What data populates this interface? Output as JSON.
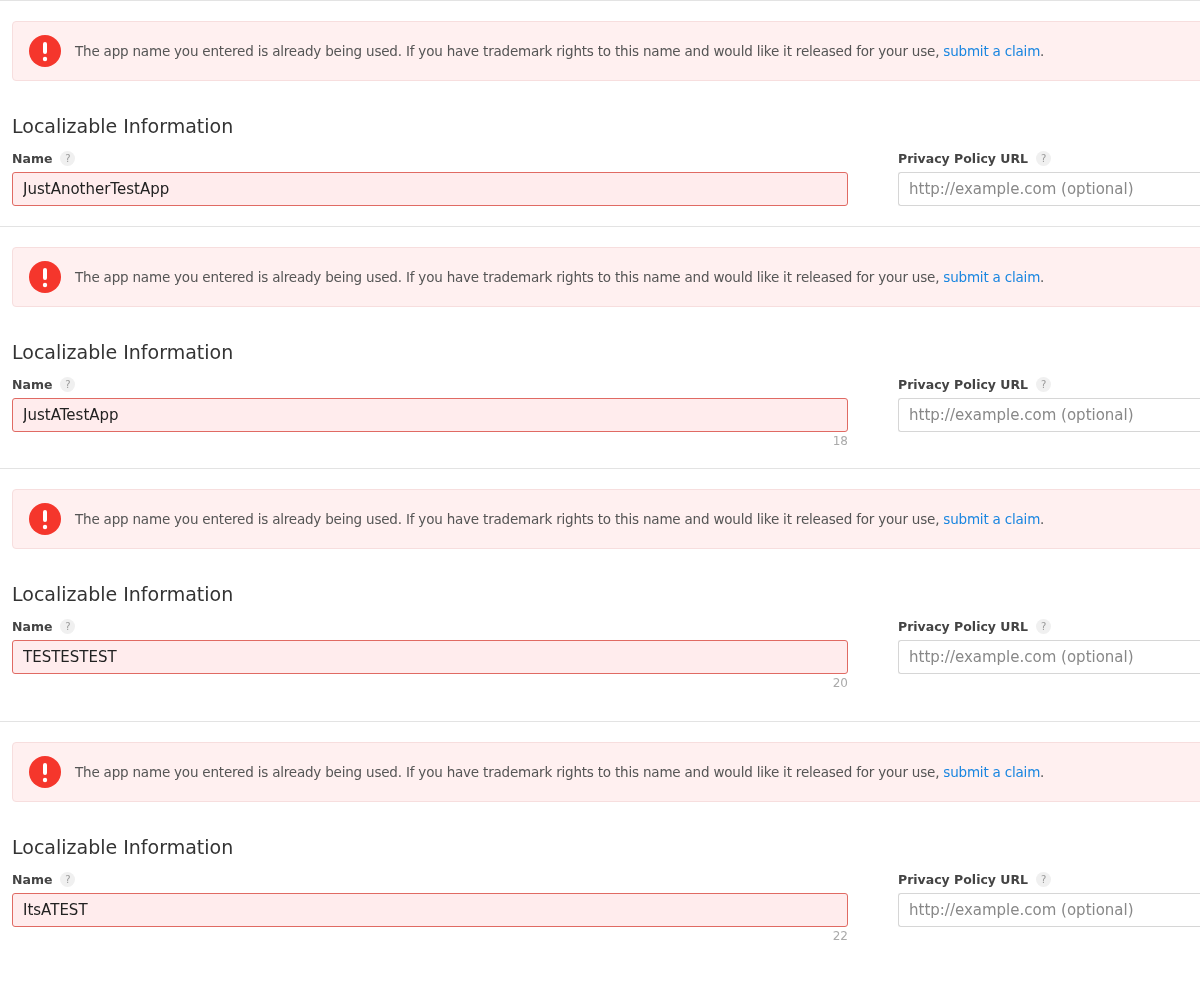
{
  "sections": [
    {
      "alert": {
        "message": "The app name you entered is already being used. If you have trademark rights to this name and would like it released for your use, ",
        "link": "submit a claim",
        "end": "."
      },
      "heading": "Localizable Information",
      "name_field": {
        "label": "Name",
        "help": "?",
        "value": "JustAnotherTestApp"
      },
      "privacy_field": {
        "label": "Privacy Policy URL",
        "help": "?",
        "placeholder": "http://example.com (optional)"
      }
    },
    {
      "alert": {
        "message": "The app name you entered is already being used. If you have trademark rights to this name and would like it released for your use, ",
        "link": "submit a claim",
        "end": "."
      },
      "heading": "Localizable Information",
      "name_field": {
        "label": "Name",
        "help": "?",
        "value": "JustATestApp",
        "count": "18"
      },
      "privacy_field": {
        "label": "Privacy Policy URL",
        "help": "?",
        "placeholder": "http://example.com (optional)"
      }
    },
    {
      "alert": {
        "message": "The app name you entered is already being used. If you have trademark rights to this name and would like it released for your use, ",
        "link": "submit a claim",
        "end": "."
      },
      "heading": "Localizable Information",
      "name_field": {
        "label": "Name",
        "help": "?",
        "value": "TESTESTEST",
        "count": "20"
      },
      "privacy_field": {
        "label": "Privacy Policy URL",
        "help": "?",
        "placeholder": "http://example.com (optional)"
      }
    },
    {
      "alert": {
        "message": "The app name you entered is already being used. If you have trademark rights to this name and would like it released for your use, ",
        "link": "submit a claim",
        "end": "."
      },
      "heading": "Localizable Information",
      "name_field": {
        "label": "Name",
        "help": "?",
        "value": "ItsATEST",
        "count": "22"
      },
      "privacy_field": {
        "label": "Privacy Policy URL",
        "help": "?",
        "placeholder": "http://example.com (optional)"
      }
    }
  ]
}
